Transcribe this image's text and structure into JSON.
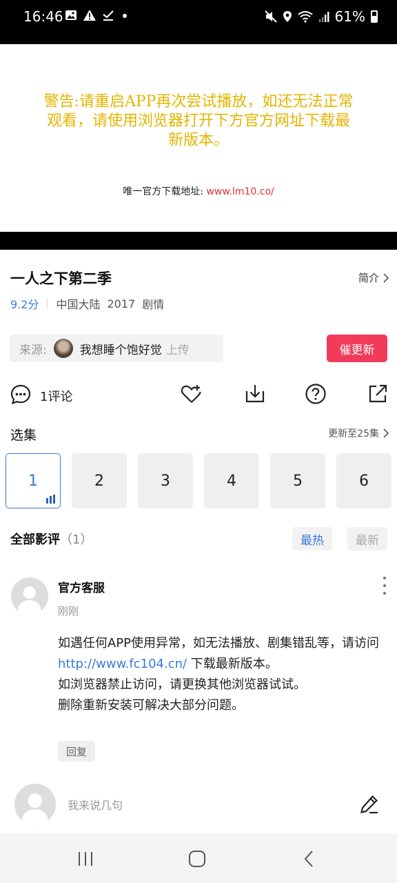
{
  "status_bar": {
    "time": "16:46",
    "battery": "61%",
    "left_icons": [
      "image-icon",
      "warning-icon",
      "download-check-icon",
      "dot-icon"
    ],
    "right_icons": [
      "mute-icon",
      "location-icon",
      "wifi-icon",
      "signal-icon",
      "battery-icon"
    ]
  },
  "video": {
    "warning": "警告:请重启APP再次尝试播放，如还无法正常观看，请使用浏览器打开下方官方网址下载最新版本。",
    "download_label": "唯一官方下载地址: ",
    "download_url": "www.lm10.co/",
    "warning_color": "#e6b400",
    "url_color": "#e03030"
  },
  "show": {
    "title": "一人之下第二季",
    "intro_label": "简介",
    "score": "9.2分",
    "region": "中国大陆",
    "year": "2017",
    "genre": "剧情"
  },
  "source": {
    "label": "来源:",
    "uploader": "我想睡个饱好觉",
    "action": "上传"
  },
  "urge_button": "催更新",
  "actions": {
    "comment_count": "1评论",
    "icons": [
      "comment-icon",
      "favorite-add-icon",
      "download-icon",
      "help-icon",
      "share-icon"
    ]
  },
  "episodes": {
    "title": "选集",
    "update_text": "更新至25集",
    "items": [
      "1",
      "2",
      "3",
      "4",
      "5",
      "6"
    ],
    "active": "1",
    "accent": "#3b7ad6"
  },
  "reviews": {
    "title": "全部影评",
    "count": "（1）",
    "sort_hot": "最热",
    "sort_new": "最新",
    "items": [
      {
        "author": "官方客服",
        "time": "刚刚",
        "line1": "如遇任何APP使用异常，如无法播放、剧集错乱等，请访问",
        "link": "http://www.fc104.cn/",
        "line2": " 下载最新版本。",
        "line3": "如浏览器禁止访问，请更换其他浏览器试试。",
        "line4": "删除重新安装可解决大部分问题。",
        "reply": "回复"
      }
    ]
  },
  "comment_input": {
    "placeholder": "我来说几句"
  },
  "brand_color": "#f23a5a"
}
